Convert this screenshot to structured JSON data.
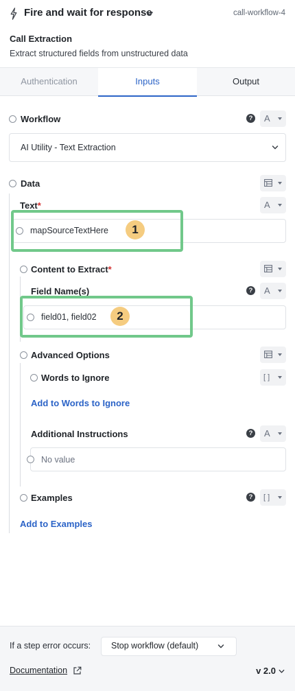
{
  "header": {
    "title": "Fire and wait for response",
    "step_id": "call-workflow-4"
  },
  "subheader": {
    "title": "Call Extraction",
    "description": "Extract structured fields from unstructured data"
  },
  "tabs": [
    {
      "label": "Authentication",
      "active": false
    },
    {
      "label": "Inputs",
      "active": true
    },
    {
      "label": "Output",
      "active": false
    }
  ],
  "workflow": {
    "label": "Workflow",
    "type_glyph": "A",
    "selected": "AI Utility - Text Extraction"
  },
  "data": {
    "label": "Data",
    "type_icon": "table-icon",
    "text": {
      "label": "Text",
      "required_mark": "*",
      "type_glyph": "A",
      "value": "mapSourceTextHere"
    },
    "content_to_extract": {
      "label": "Content to Extract",
      "required_mark": "*",
      "type_icon": "table-icon",
      "field_names": {
        "label": "Field Name(s)",
        "type_glyph": "A",
        "value": "field01, field02"
      }
    },
    "advanced_options": {
      "label": "Advanced Options",
      "type_icon": "table-icon",
      "words_to_ignore": {
        "label": "Words to Ignore",
        "type_glyph": "[ ]",
        "add_link": "Add to Words to Ignore"
      },
      "additional_instructions": {
        "label": "Additional Instructions",
        "type_glyph": "A",
        "placeholder": "No value"
      }
    },
    "examples": {
      "label": "Examples",
      "type_glyph": "[ ]",
      "add_link": "Add to Examples"
    }
  },
  "annotations": {
    "badge_1": "1",
    "badge_2": "2",
    "highlight_color": "#71c88a",
    "badge_color": "#f5cc80"
  },
  "footer": {
    "error_label": "If a step error occurs:",
    "error_option": "Stop workflow (default)",
    "documentation_link": "Documentation",
    "version": "v 2.0"
  },
  "colors": {
    "accent": "#2b63c7",
    "required": "#d32f2f"
  }
}
